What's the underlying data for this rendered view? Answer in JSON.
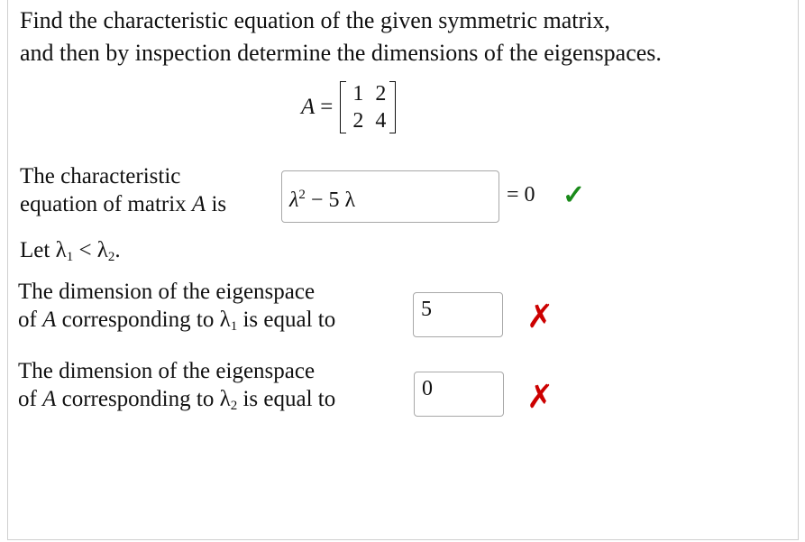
{
  "problem": {
    "line1": "Find the characteristic equation of the given symmetric matrix,",
    "line2": "and then by inspection determine the dimensions of the eigenspaces."
  },
  "matrix": {
    "name": "A",
    "equals": "=",
    "rows": [
      [
        "1",
        "2"
      ],
      [
        "2",
        "4"
      ]
    ]
  },
  "char_eq": {
    "label_line1": "The characteristic",
    "label_line2_pre": "equation of matrix ",
    "label_var": "A",
    "label_line2_post": " is",
    "answer_base": "λ",
    "answer_exp": "2",
    "answer_rest": " − 5 λ",
    "rhs": "= 0",
    "status": "correct",
    "status_icon": "✓",
    "status_color": "#1a8a1a"
  },
  "ordering": {
    "pre": "Let λ",
    "sub1": "1",
    "mid": " < λ",
    "sub2": "2",
    "post": "."
  },
  "dim1": {
    "line1": "The dimension of the eigenspace",
    "pre": "of ",
    "var": "A",
    "mid": " corresponding to λ",
    "sub": "1",
    "post": " is equal to",
    "value": "5",
    "status": "incorrect",
    "status_icon": "✗",
    "status_color": "#cc0000"
  },
  "dim2": {
    "line1": "The dimension of the eigenspace",
    "pre": "of ",
    "var": "A",
    "mid": " corresponding to λ",
    "sub": "2",
    "post": " is equal to",
    "value": "0",
    "status": "incorrect",
    "status_icon": "✗",
    "status_color": "#cc0000"
  }
}
